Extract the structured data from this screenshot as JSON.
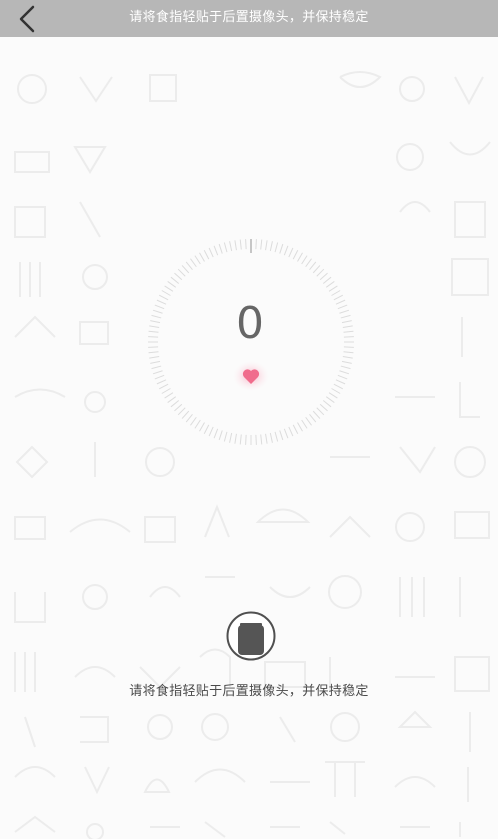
{
  "header": {
    "title": "请将食指轻贴于后置摄像头，并保持稳定",
    "back_icon": "chevron-left-icon"
  },
  "measurement": {
    "value": "0",
    "heart_icon": "heart-icon",
    "heart_color": "#f06c8c"
  },
  "camera_button": {
    "icon": "camera-lens-icon"
  },
  "instruction": {
    "text": "请将食指轻贴于后置摄像头，并保持稳定"
  },
  "colors": {
    "header_bg": "#b7b7b7",
    "page_bg": "#fbfbfb",
    "ring_ticks": "#dcdcdc",
    "number": "#666666"
  }
}
